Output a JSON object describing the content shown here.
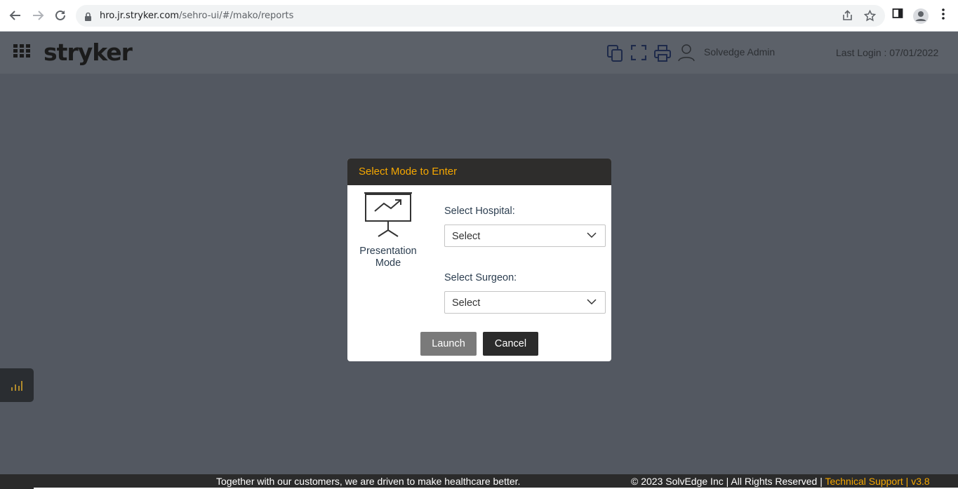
{
  "browser": {
    "url_host": "hro.jr.stryker.com",
    "url_path": "/sehro-ui/#/mako/reports"
  },
  "header": {
    "logo": "stryker",
    "user_name": "Solvedge Admin",
    "last_login": "Last Login : 07/01/2022"
  },
  "modal": {
    "title": "Select Mode to Enter",
    "mode_label_line1": "Presentation",
    "mode_label_line2": "Mode",
    "hospital_label": "Select Hospital:",
    "hospital_value": "Select",
    "surgeon_label": "Select Surgeon:",
    "surgeon_value": "Select",
    "launch_label": "Launch",
    "cancel_label": "Cancel"
  },
  "footer": {
    "tagline": "Together with our customers, we are driven to make healthcare better.",
    "copyright": "© 2023 SolvEdge Inc | All Rights Reserved | ",
    "support": "Technical Support | v3.8"
  },
  "colors": {
    "accent": "#f5a700",
    "overlay": "#535861",
    "modal_header": "#2e2d2c"
  },
  "icons": [
    "back-icon",
    "forward-icon",
    "reload-icon",
    "lock-icon",
    "share-icon",
    "star-icon",
    "side-panel-icon",
    "profile-icon",
    "kebab-menu-icon",
    "apps-grid-icon",
    "copy-icon",
    "fullscreen-icon",
    "print-icon",
    "user-icon",
    "presentation-icon",
    "chevron-down-icon",
    "bar-chart-icon"
  ]
}
